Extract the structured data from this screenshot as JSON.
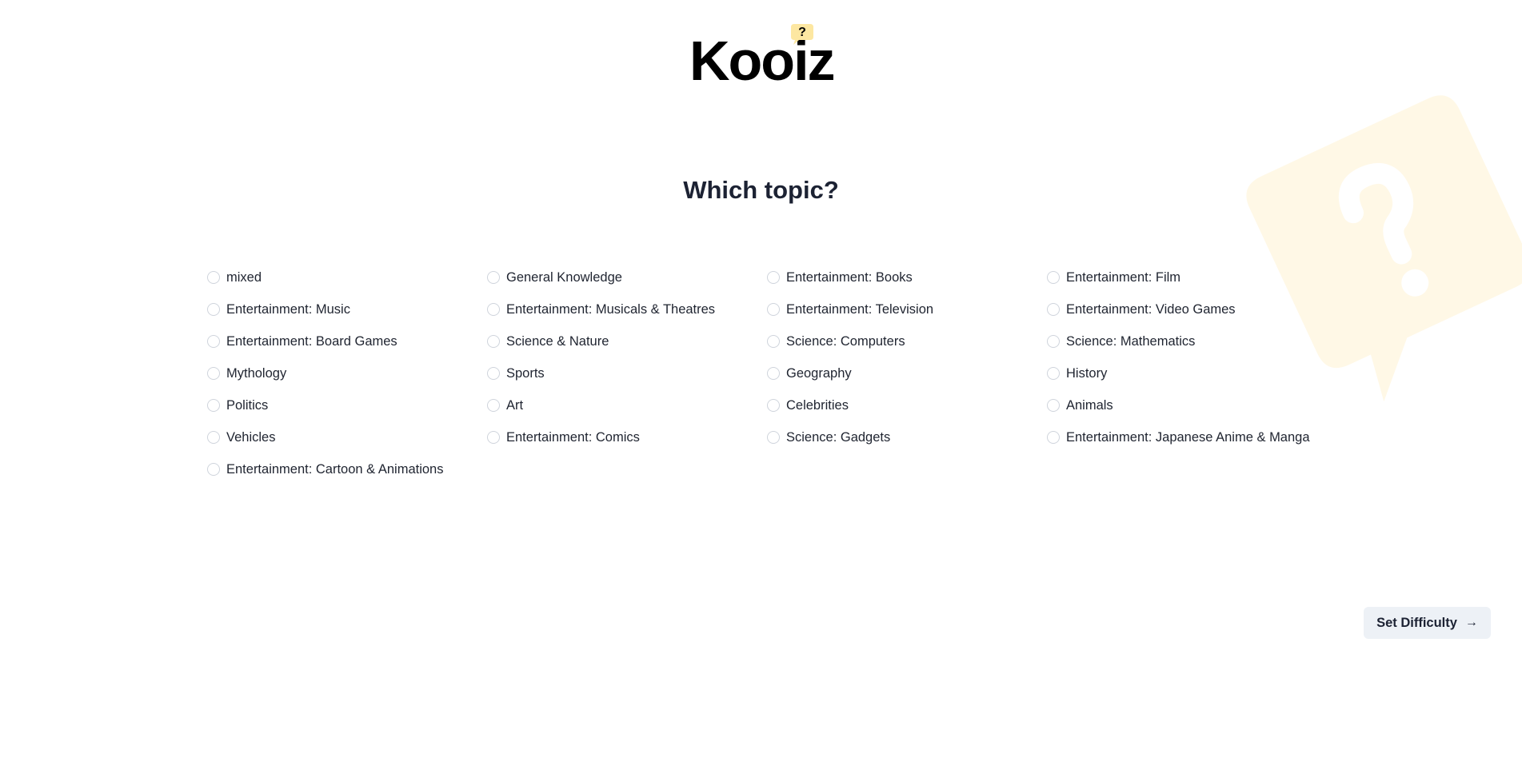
{
  "app": {
    "logo_text": "Kooiz",
    "logo_badge_glyph": "?",
    "brand_color": "#fde7a1",
    "background_bubble_color": "#fff8e6"
  },
  "page": {
    "heading": "Which topic?"
  },
  "topics": [
    {
      "label": "mixed",
      "selected": false
    },
    {
      "label": "General Knowledge",
      "selected": false
    },
    {
      "label": "Entertainment: Books",
      "selected": false
    },
    {
      "label": "Entertainment: Film",
      "selected": false
    },
    {
      "label": "Entertainment: Music",
      "selected": false
    },
    {
      "label": "Entertainment: Musicals & Theatres",
      "selected": false
    },
    {
      "label": "Entertainment: Television",
      "selected": false
    },
    {
      "label": "Entertainment: Video Games",
      "selected": false
    },
    {
      "label": "Entertainment: Board Games",
      "selected": false
    },
    {
      "label": "Science & Nature",
      "selected": false
    },
    {
      "label": "Science: Computers",
      "selected": false
    },
    {
      "label": "Science: Mathematics",
      "selected": false
    },
    {
      "label": "Mythology",
      "selected": false
    },
    {
      "label": "Sports",
      "selected": false
    },
    {
      "label": "Geography",
      "selected": false
    },
    {
      "label": "History",
      "selected": false
    },
    {
      "label": "Politics",
      "selected": false
    },
    {
      "label": "Art",
      "selected": false
    },
    {
      "label": "Celebrities",
      "selected": false
    },
    {
      "label": "Animals",
      "selected": false
    },
    {
      "label": "Vehicles",
      "selected": false
    },
    {
      "label": "Entertainment: Comics",
      "selected": false
    },
    {
      "label": "Science: Gadgets",
      "selected": false
    },
    {
      "label": "Entertainment: Japanese Anime & Manga",
      "selected": false
    },
    {
      "label": "Entertainment: Cartoon & Animations",
      "selected": false
    }
  ],
  "actions": {
    "next_label": "Set Difficulty",
    "next_icon": "arrow-right-icon"
  }
}
